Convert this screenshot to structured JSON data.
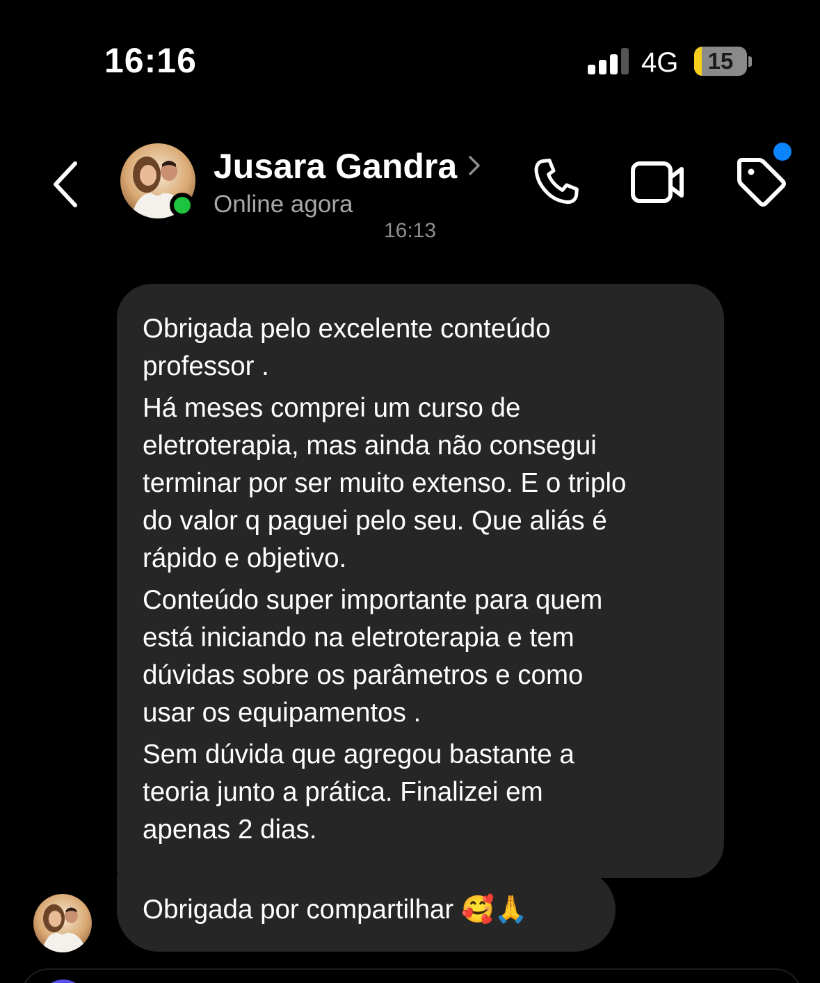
{
  "status_bar": {
    "time": "16:16",
    "network": "4G",
    "battery": "15",
    "battery_level": 0.15
  },
  "header": {
    "back_icon": "chevron-left-icon",
    "contact_name": "Jusara Gandra",
    "contact_status": "Online agora",
    "call_icon": "phone-icon",
    "video_icon": "video-camera-icon",
    "tag_icon": "tag-icon",
    "colors": {
      "online": "#1dc43f",
      "notification": "#0a84ff"
    }
  },
  "chat": {
    "timestamp": "16:13",
    "messages": [
      {
        "paragraphs": [
          "Obrigada pelo excelente conteúdo\nprofessor .",
          "Há meses comprei um curso de\neletroterapia, mas ainda não consegui\nterminar por ser muito extenso. E o triplo\ndo valor q paguei pelo seu. Que aliás é\nrápido e objetivo.",
          "Conteúdo super importante para quem\nestá iniciando na eletroterapia e tem\ndúvidas sobre os parâmetros e como\nusar os equipamentos .",
          "Sem dúvida que agregou bastante a\nteoria junto a prática. Finalizei em\napenas 2 dias."
        ]
      },
      {
        "text": "Obrigada por compartilhar 🥰🙏"
      }
    ],
    "bubble_color": "#262626"
  }
}
